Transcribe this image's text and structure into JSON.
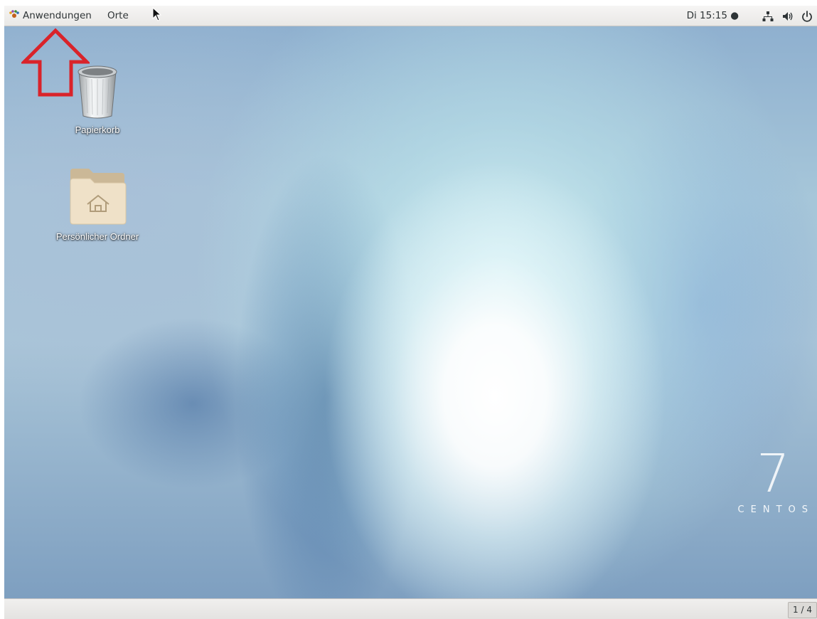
{
  "top_panel": {
    "applications_label": "Anwendungen",
    "places_label": "Orte",
    "clock": "Di 15:15 ●",
    "status_icons": [
      "network-icon",
      "volume-icon",
      "power-icon"
    ]
  },
  "desktop": {
    "icons": [
      {
        "label": "Papierkorb",
        "icon": "trash-icon"
      },
      {
        "label": "Persönlicher Ordner",
        "icon": "home-folder-icon"
      }
    ],
    "branding": {
      "version": "7",
      "name": "CENTOS"
    },
    "annotation_color": "#d9232a"
  },
  "bottom_panel": {
    "workspace": "1 / 4"
  }
}
